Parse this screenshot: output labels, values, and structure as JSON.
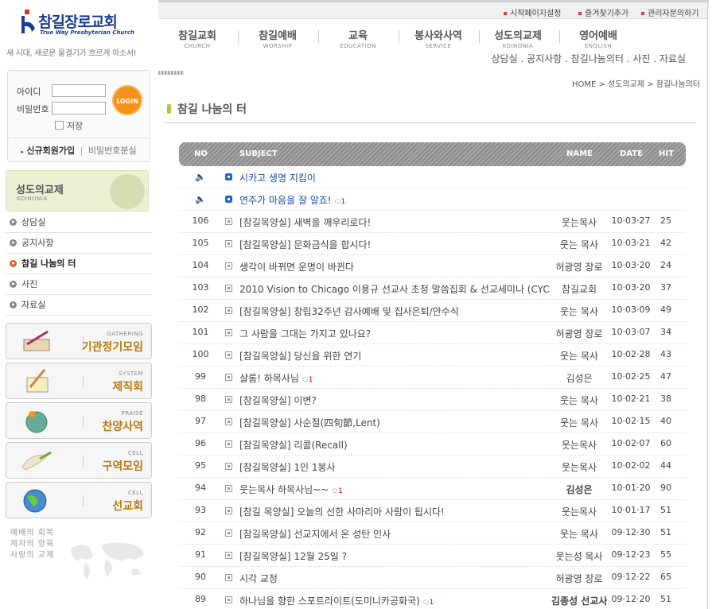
{
  "logo": {
    "name": "참길장로교회",
    "sub": "True Way Presbyterian Church"
  },
  "slogan": "새 시대, 새로운 물결기가 흐르게 하소서!",
  "login": {
    "id_label": "아이디",
    "pw_label": "비밀번호",
    "button": "LOGIN",
    "save_label": "저장",
    "join": "신규회원가입",
    "find": "비밀번호분실"
  },
  "section": {
    "title": "성도의교제",
    "en": "KOINONIA"
  },
  "side_menu": [
    "상담실",
    "공지사항",
    "참길 나눔의 터",
    "사진",
    "자료실"
  ],
  "banners": [
    {
      "en": "GATHERING",
      "ko": "기관정기모임"
    },
    {
      "en": "SYSTEM",
      "ko": "제직회"
    },
    {
      "en": "PRAISE",
      "ko": "찬양사역"
    },
    {
      "en": "CELL",
      "ko": "구역모임"
    },
    {
      "en": "CELL",
      "ko": "선교회"
    }
  ],
  "footer_lines": [
    "예배의 회복",
    "제자의 양육",
    "사랑의 교제"
  ],
  "util_links": [
    "시작페이지설정",
    "즐겨찾기추가",
    "관리자문의하기"
  ],
  "gnb": [
    {
      "ko": "참길교회",
      "en": "CHURCH"
    },
    {
      "ko": "참길예배",
      "en": "WORSHIP"
    },
    {
      "ko": "교육",
      "en": "EDUCATION"
    },
    {
      "ko": "봉사와사역",
      "en": "SERVICE"
    },
    {
      "ko": "성도의교제",
      "en": "KOINONIA"
    },
    {
      "ko": "영어예배",
      "en": "ENGLISH"
    }
  ],
  "submenu": "상담실 . 공지사항 . 참길나눔의터 . 사진 . 자료실",
  "breadcrumb": "HOME > 성도의교제 > 참길나눔의터",
  "page_title": "참길 나눔의 터",
  "table": {
    "headers": {
      "no": "NO",
      "subject": "SUBJECT",
      "name": "NAME",
      "date": "DATE",
      "hit": "HIT"
    },
    "notices": [
      {
        "subject": "시카고 생명 지킴이",
        "comments": ""
      },
      {
        "subject": "연주가 마음을 잘 알죠!",
        "comments": "1"
      }
    ],
    "rows": [
      {
        "no": "106",
        "subject": "[참길목양실] 새벽을 깨우리로다!",
        "comments": "",
        "name": "웃는목사",
        "date": "10·03·27",
        "hit": "25"
      },
      {
        "no": "105",
        "subject": "[참길목양실] 문화금식을 합시다!",
        "comments": "",
        "name": "웃는 목사",
        "date": "10·03·21",
        "hit": "42"
      },
      {
        "no": "104",
        "subject": "생각이 바뀌면 운명이 바뀐다",
        "comments": "",
        "name": "허광영 장로",
        "date": "10·03·20",
        "hit": "24"
      },
      {
        "no": "103",
        "subject": "2010 Vision to Chicago 이용규 선교사 초청 말씀집회 & 선교세미나 (CYC",
        "comments": "",
        "name": "참길교회",
        "date": "10·03·20",
        "hit": "37"
      },
      {
        "no": "102",
        "subject": "[참길목양실] 창립32주년 감사예배 및 집사은퇴/안수식",
        "comments": "",
        "name": "웃는 목사",
        "date": "10·03·09",
        "hit": "49"
      },
      {
        "no": "101",
        "subject": "그 사람을 그대는 가지고 있나요?",
        "comments": "",
        "name": "허광영 장로",
        "date": "10·03·07",
        "hit": "34"
      },
      {
        "no": "100",
        "subject": "[참길목양실] 당신을 위한 연기",
        "comments": "",
        "name": "웃는 목사",
        "date": "10·02·28",
        "hit": "43"
      },
      {
        "no": "99",
        "subject": "샬롬! 하목사님",
        "comments": "1",
        "name": "김성은",
        "date": "10·02·25",
        "hit": "47"
      },
      {
        "no": "98",
        "subject": "[참길목양실] 이변?",
        "comments": "",
        "name": "웃는 목사",
        "date": "10·02·21",
        "hit": "38"
      },
      {
        "no": "97",
        "subject": "[참길목양실] 사순절(四旬節,Lent)",
        "comments": "",
        "name": "웃는 목사",
        "date": "10·02·15",
        "hit": "40"
      },
      {
        "no": "96",
        "subject": "[참길목양실] 리콜(Recall)",
        "comments": "",
        "name": "웃는목사",
        "date": "10·02·07",
        "hit": "60"
      },
      {
        "no": "95",
        "subject": "[참길목양실] 1인 1봉사",
        "comments": "",
        "name": "웃는목사",
        "date": "10·02·02",
        "hit": "44"
      },
      {
        "no": "94",
        "subject": "웃는목사 하목사님~~",
        "comments": "1",
        "name": "김성은",
        "date": "10·01·20",
        "hit": "90"
      },
      {
        "no": "93",
        "subject": "[참길 목양실] 오늘의 선한 사마리아 사람이 됩시다!",
        "comments": "",
        "name": "웃는목사",
        "date": "10·01·17",
        "hit": "51"
      },
      {
        "no": "92",
        "subject": "[참길목양실] 선교지에서 온 성탄 인사",
        "comments": "",
        "name": "웃는 목사",
        "date": "09·12·30",
        "hit": "51"
      },
      {
        "no": "91",
        "subject": "[참길목양실] 12월 25일 ?",
        "comments": "",
        "name": "웃는성 목사",
        "date": "09·12·23",
        "hit": "55"
      },
      {
        "no": "90",
        "subject": "시각 교정",
        "comments": "",
        "name": "허광영 장로",
        "date": "09·12·22",
        "hit": "65"
      },
      {
        "no": "89",
        "subject": "하나님을 향한 스포트라이트(도미니카공화국)",
        "comments": "1",
        "name": "김종성 선교사",
        "date": "09·12·20",
        "hit": "51"
      }
    ]
  },
  "colors": {
    "accent": "#f39218",
    "title_bullet": "#c9b740",
    "notice": "#1a4ea0",
    "comment": "#cc0000"
  }
}
